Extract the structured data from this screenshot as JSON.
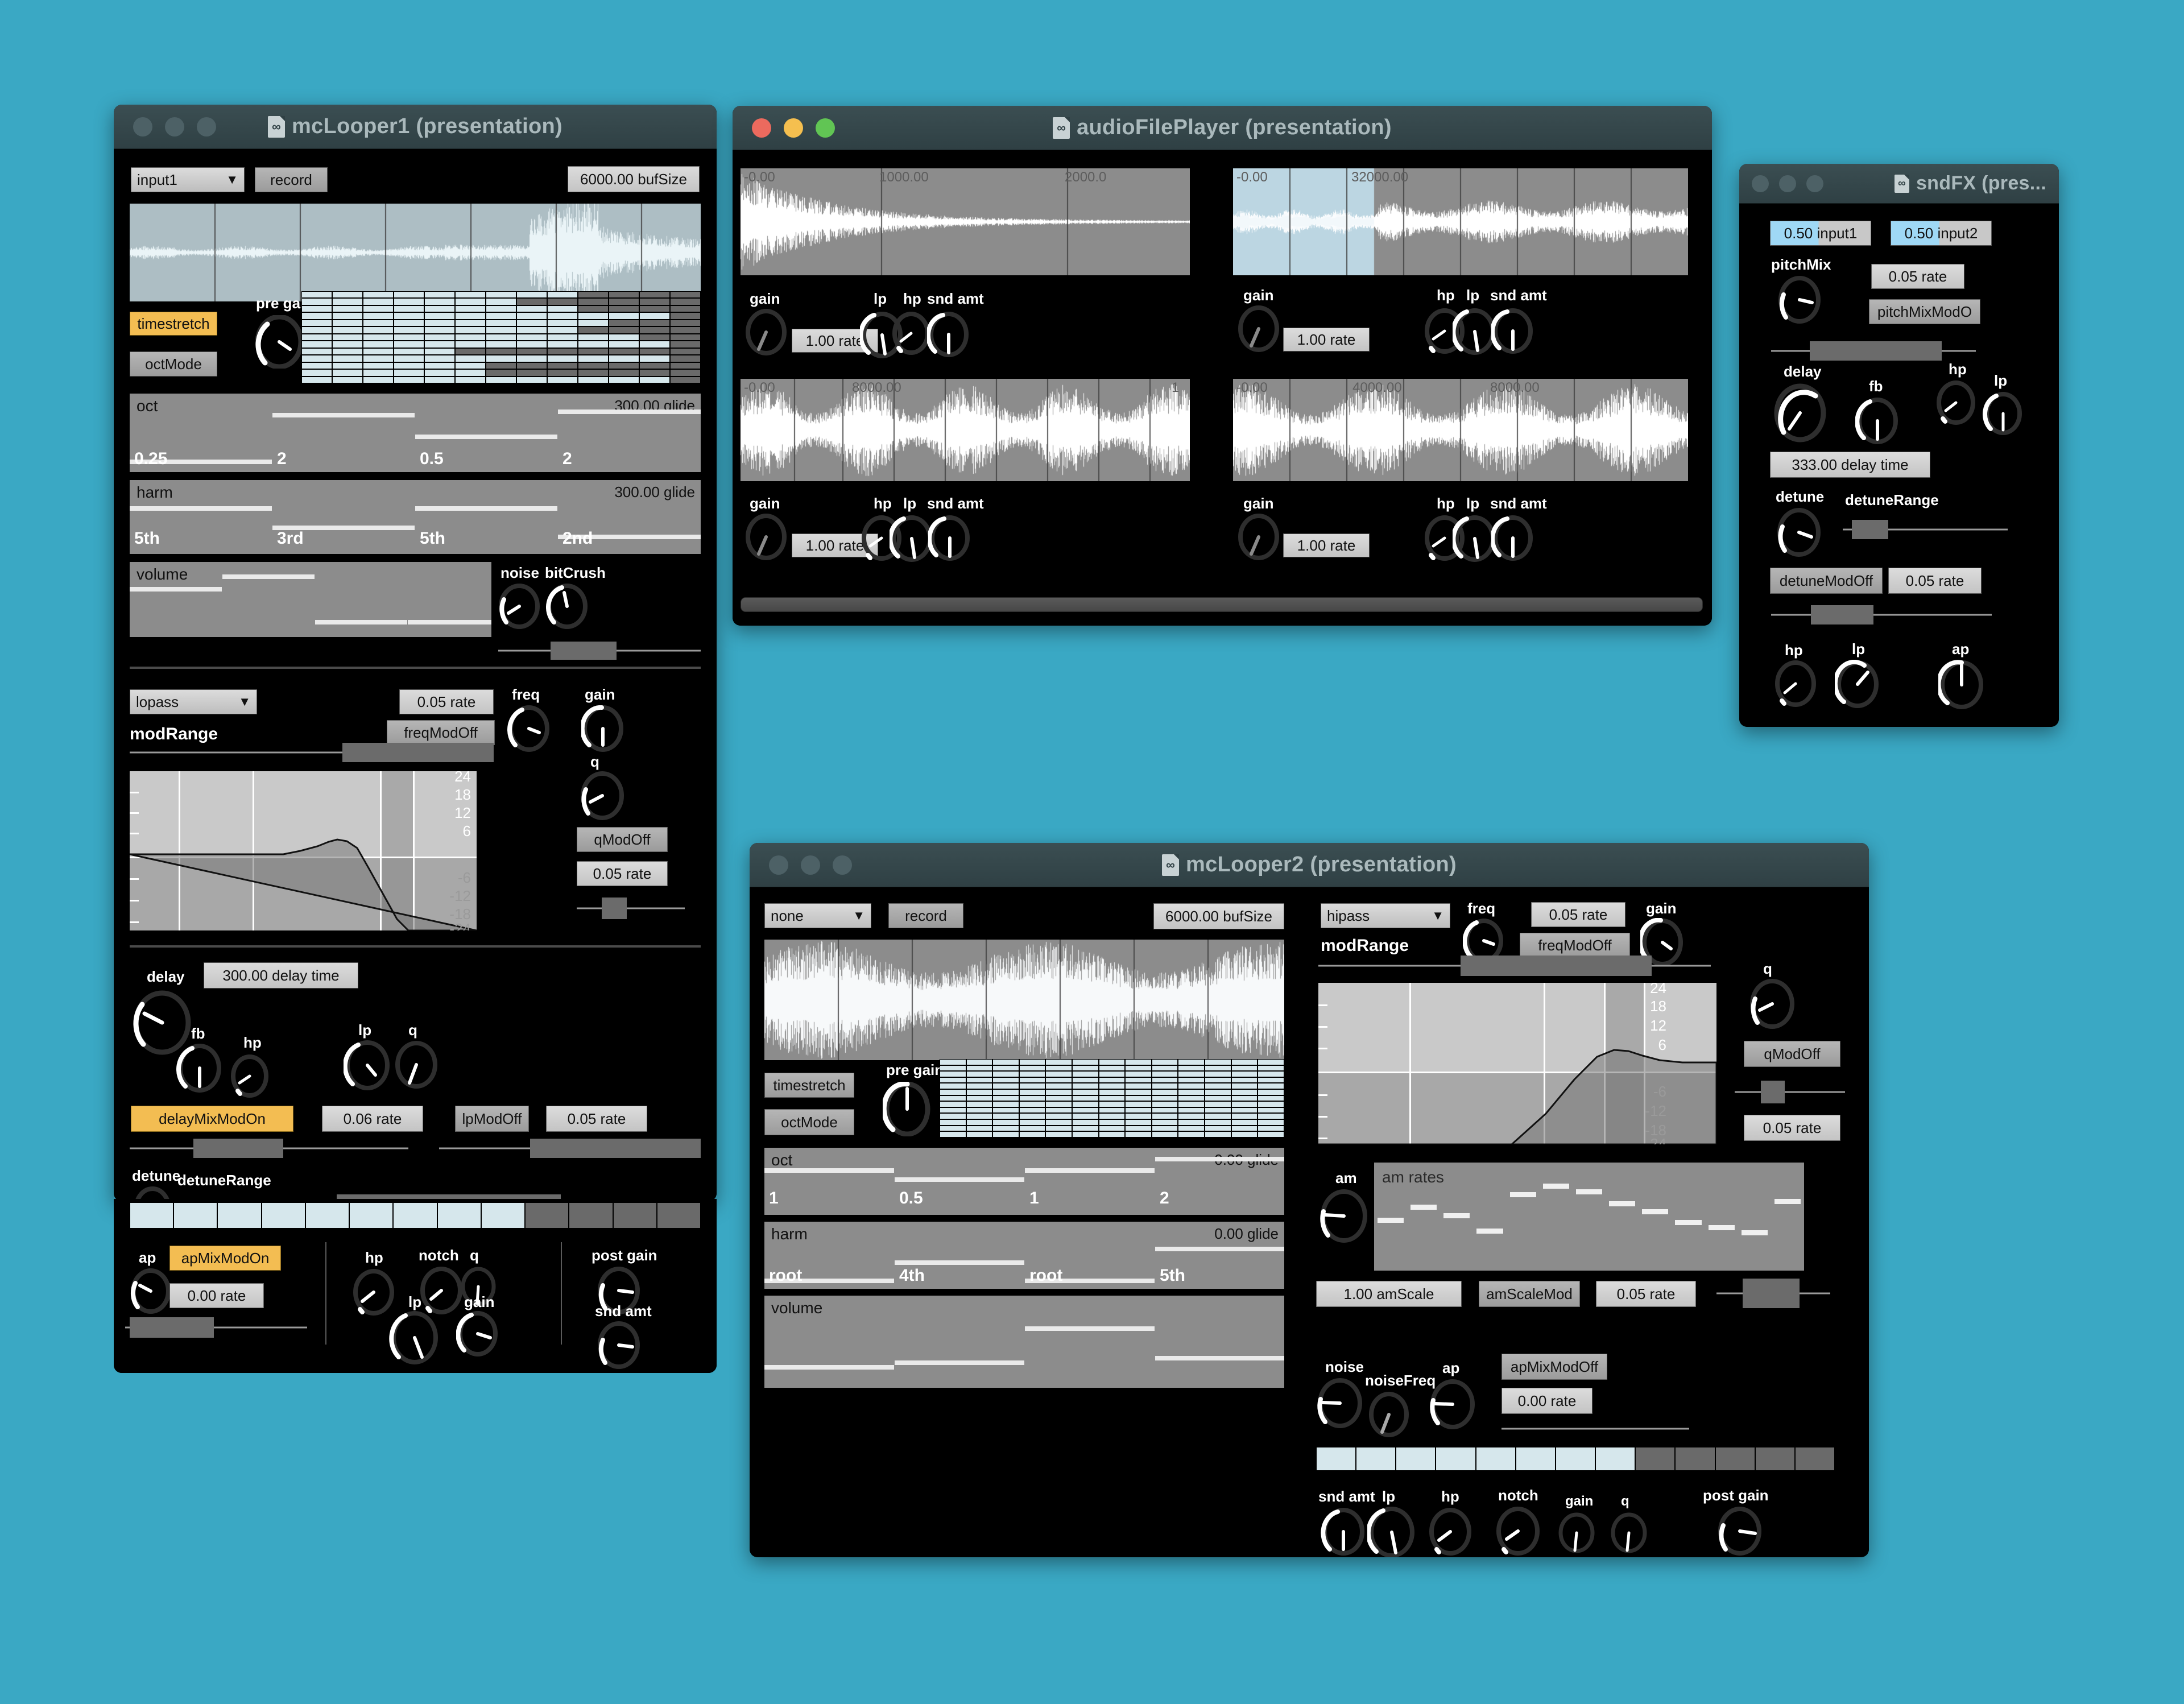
{
  "desktop": {
    "background": "#3aa8c4"
  },
  "windows": {
    "mclooper1": {
      "title": "mcLooper1 (presentation)",
      "active": false,
      "source_select": "input1",
      "record_label": "record",
      "bufsize": "6000.00 bufSize",
      "timestretch_label": "timestretch",
      "timestretch_on": true,
      "octmode_label": "octMode",
      "pregain_label": "pre gain",
      "oct": {
        "name": "oct",
        "glide": "300.00 glide",
        "values": [
          "0.25",
          "2",
          "0.5",
          "2"
        ]
      },
      "harm": {
        "name": "harm",
        "glide": "300.00 glide",
        "values": [
          "5th",
          "3rd",
          "5th",
          "2nd"
        ]
      },
      "volume": {
        "name": "volume"
      },
      "noise_label": "noise",
      "bitcrush_label": "bitCrush",
      "filter_type": "lopass",
      "filter_rate": "0.05 rate",
      "freq_label": "freq",
      "gain_label": "gain",
      "freqmod_label": "freqModOff",
      "modrange_label": "modRange",
      "q_label": "q",
      "qmod_label": "qModOff",
      "q_rate": "0.05 rate",
      "db_labels": [
        "24",
        "18",
        "12",
        "6",
        "-6",
        "-12",
        "-18",
        "-24"
      ],
      "delay_label": "delay",
      "delay_time": "300.00 delay time",
      "fb_label": "fb",
      "hp_label": "hp",
      "lp_label": "lp",
      "delay_q_label": "q",
      "delaymix_label": "delayMixModOn",
      "delaymix_on": true,
      "delaymix_rate": "0.06 rate",
      "lpmod_label": "lpModOff",
      "lpmod_rate": "0.05 rate",
      "detune_label": "detune",
      "detunerange_label": "detuneRange",
      "ap_label": "ap",
      "apmix_label": "apMixModOn",
      "apmix_on": true,
      "apmix_rate": "0.00 rate",
      "post_hp_label": "hp",
      "post_lp_label": "lp",
      "notch_label": "notch",
      "post_q_label": "q",
      "post_gain_label": "post gain",
      "eq_gain_label": "gain",
      "snd_amt_label": "snd amt"
    },
    "audiofileplayer": {
      "title": "audioFilePlayer (presentation)",
      "active": true,
      "players": [
        {
          "id": "p1",
          "ruler": [
            "-0.00",
            "1000.00",
            "2000.0"
          ],
          "gain_label": "gain",
          "rate": "1.00 rate",
          "knobs": [
            "lp",
            "hp",
            "snd amt"
          ],
          "selection": false
        },
        {
          "id": "p2",
          "ruler": [
            "-0.00",
            "32000.00"
          ],
          "gain_label": "gain",
          "rate": "1.00 rate",
          "knobs": [
            "hp",
            "lp",
            "snd amt"
          ],
          "selection": true
        },
        {
          "id": "p3",
          "ruler": [
            "-0.00",
            "8000.00",
            "1"
          ],
          "gain_label": "gain",
          "rate": "1.00 rate",
          "knobs": [
            "hp",
            "lp",
            "snd amt"
          ],
          "selection": false
        },
        {
          "id": "p4",
          "ruler": [
            "-0.00",
            "4000.00",
            "8000.00"
          ],
          "gain_label": "gain",
          "rate": "1.00 rate",
          "knobs": [
            "hp",
            "lp",
            "snd amt"
          ],
          "selection": false
        }
      ]
    },
    "sndfx": {
      "title": "sndFX (pres...",
      "active": false,
      "input1": "0.50 input1",
      "input2": "0.50 input2",
      "pitchmix_label": "pitchMix",
      "pitchmix_rate": "0.05 rate",
      "pitchmixmod_label": "pitchMixModO",
      "delay_label": "delay",
      "fb_label": "fb",
      "hp_label": "hp",
      "lp_label": "lp",
      "delay_time": "333.00 delay time",
      "detune_label": "detune",
      "detunerange_label": "detuneRange",
      "detunemod_label": "detuneModOff",
      "detunemod_rate": "0.05 rate",
      "out_hp_label": "hp",
      "out_lp_label": "lp",
      "out_ap_label": "ap"
    },
    "mclooper2": {
      "title": "mcLooper2 (presentation)",
      "active": false,
      "source_select": "none",
      "record_label": "record",
      "bufsize": "6000.00 bufSize",
      "timestretch_label": "timestretch",
      "timestretch_on": false,
      "octmode_label": "octMode",
      "pregain_label": "pre gain",
      "oct": {
        "name": "oct",
        "glide": "0.00 glide",
        "values": [
          "1",
          "0.5",
          "1",
          "2"
        ]
      },
      "harm": {
        "name": "harm",
        "glide": "0.00 glide",
        "values": [
          "root",
          "4th",
          "root",
          "5th"
        ]
      },
      "volume": {
        "name": "volume"
      },
      "filter_type": "hipass",
      "freq_label": "freq",
      "filter_rate": "0.05 rate",
      "gain_label": "gain",
      "freqmod_label": "freqModOff",
      "modrange_label": "modRange",
      "q_label": "q",
      "qmod_label": "qModOff",
      "q_rate": "0.05 rate",
      "db_labels": [
        "24",
        "18",
        "12",
        "6",
        "-6",
        "-12",
        "-18",
        "-24"
      ],
      "am_label": "am",
      "amrates_label": "am rates",
      "amscale": "1.00 amScale",
      "amscalemod_label": "amScaleMod",
      "amscale_rate": "0.05 rate",
      "noise_label": "noise",
      "noisefreq_label": "noiseFreq",
      "ap_label": "ap",
      "apmix_label": "apMixModOff",
      "apmix_rate": "0.00 rate",
      "snd_amt_label": "snd amt",
      "lp_label": "lp",
      "hp_label": "hp",
      "notch_label": "notch",
      "eq_gain_label": "gain",
      "post_q_label": "q",
      "post_gain_label": "post gain"
    }
  }
}
